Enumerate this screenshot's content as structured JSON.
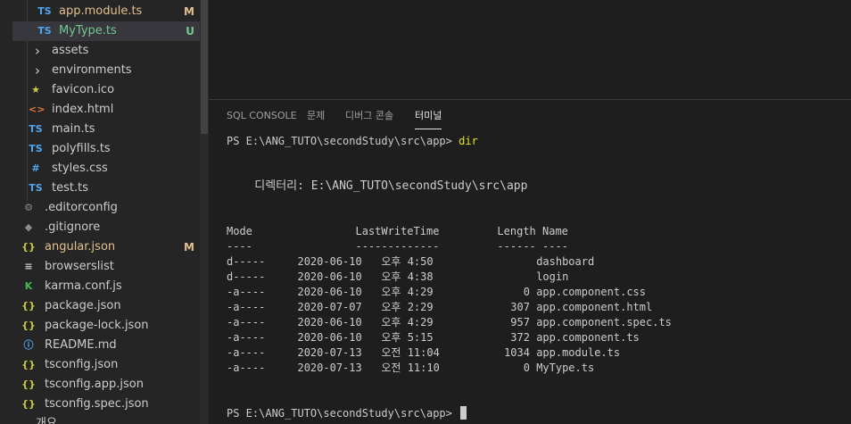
{
  "colors": {
    "ts_blue": "#4fa6ed",
    "modified": "#e2c08d",
    "untracked": "#73c991",
    "json_yellow": "#cbcb41",
    "html_orange": "#e37933",
    "favicon_yellow": "#cbcb41"
  },
  "explorer": {
    "files": [
      {
        "icon": "TS",
        "icon_name": "typescript-icon",
        "name": "app.module.ts",
        "status": "M"
      },
      {
        "icon": "TS",
        "icon_name": "typescript-icon",
        "name": "MyType.ts",
        "status": "U"
      },
      {
        "icon": "›",
        "icon_name": "chevron-right-icon",
        "name": "assets",
        "status": ""
      },
      {
        "icon": "›",
        "icon_name": "chevron-right-icon",
        "name": "environments",
        "status": ""
      },
      {
        "icon": "★",
        "icon_name": "star-icon",
        "name": "favicon.ico",
        "status": ""
      },
      {
        "icon": "<>",
        "icon_name": "html-icon",
        "name": "index.html",
        "status": ""
      },
      {
        "icon": "TS",
        "icon_name": "typescript-icon",
        "name": "main.ts",
        "status": ""
      },
      {
        "icon": "TS",
        "icon_name": "typescript-icon",
        "name": "polyfills.ts",
        "status": ""
      },
      {
        "icon": "#",
        "icon_name": "css-icon",
        "name": "styles.css",
        "status": ""
      },
      {
        "icon": "TS",
        "icon_name": "typescript-icon",
        "name": "test.ts",
        "status": ""
      },
      {
        "icon": "⚙",
        "icon_name": "gear-icon",
        "name": ".editorconfig",
        "status": ""
      },
      {
        "icon": "◆",
        "icon_name": "git-icon",
        "name": ".gitignore",
        "status": ""
      },
      {
        "icon": "{}",
        "icon_name": "json-icon",
        "name": "angular.json",
        "status": "M"
      },
      {
        "icon": "≡",
        "icon_name": "list-icon",
        "name": "browserslist",
        "status": ""
      },
      {
        "icon": "K",
        "icon_name": "karma-icon",
        "name": "karma.conf.js",
        "status": ""
      },
      {
        "icon": "{}",
        "icon_name": "json-icon",
        "name": "package.json",
        "status": ""
      },
      {
        "icon": "{}",
        "icon_name": "json-icon",
        "name": "package-lock.json",
        "status": ""
      },
      {
        "icon": "ⓘ",
        "icon_name": "info-icon",
        "name": "README.md",
        "status": ""
      },
      {
        "icon": "{}",
        "icon_name": "json-icon",
        "name": "tsconfig.json",
        "status": ""
      },
      {
        "icon": "{}",
        "icon_name": "json-icon",
        "name": "tsconfig.app.json",
        "status": ""
      },
      {
        "icon": "{}",
        "icon_name": "json-icon",
        "name": "tsconfig.spec.json",
        "status": ""
      },
      {
        "icon": "",
        "icon_name": "",
        "name": "개요",
        "status": ""
      }
    ]
  },
  "panel": {
    "tabs": [
      "SQL CONSOLE",
      "문제",
      "디버그 콘솔",
      "터미널"
    ]
  },
  "terminal": {
    "prompt": "PS E:\\ANG_TUTO\\secondStudy\\src\\app> ",
    "command": "dir",
    "directory_line": "    디렉터리: E:\\ANG_TUTO\\secondStudy\\src\\app",
    "header": "Mode                LastWriteTime         Length Name",
    "separator": "----                -------------         ------ ----",
    "rows": [
      "d-----     2020-06-10   오후 4:50                dashboard",
      "d-----     2020-06-10   오후 4:38                login",
      "-a----     2020-06-10   오후 4:29              0 app.component.css",
      "-a----     2020-07-07   오후 2:29            307 app.component.html",
      "-a----     2020-06-10   오후 4:29            957 app.component.spec.ts",
      "-a----     2020-06-10   오후 5:15            372 app.component.ts",
      "-a----     2020-07-13   오전 11:04          1034 app.module.ts",
      "-a----     2020-07-13   오전 11:10             0 MyType.ts"
    ],
    "final_prompt": "PS E:\\ANG_TUTO\\secondStudy\\src\\app> "
  }
}
